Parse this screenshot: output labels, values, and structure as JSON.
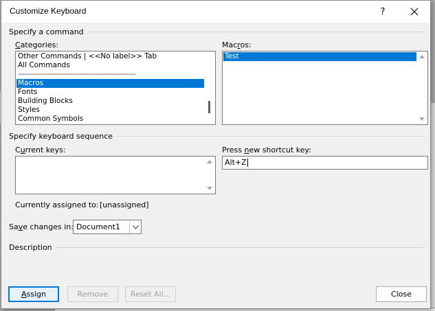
{
  "dialog": {
    "title": "Customize Keyboard",
    "help_label": "?"
  },
  "command_group": {
    "heading": "Specify a command",
    "categories_label_pre": "",
    "categories_label_u": "C",
    "categories_label_post": "ategories:",
    "categories": [
      {
        "label": "Other Commands | <<No label>> Tab",
        "selected": false
      },
      {
        "label": "All Commands",
        "selected": false
      },
      {
        "label": "----------------------------------------------------",
        "selected": false,
        "separator": true
      },
      {
        "label": "Macros",
        "selected": true
      },
      {
        "label": "Fonts",
        "selected": false
      },
      {
        "label": "Building Blocks",
        "selected": false
      },
      {
        "label": "Styles",
        "selected": false
      },
      {
        "label": "Common Symbols",
        "selected": false
      }
    ],
    "macros_label_pre": "Mac",
    "macros_label_u": "r",
    "macros_label_post": "os:",
    "macros": [
      {
        "label": "Test",
        "selected": true
      }
    ]
  },
  "keyboard_group": {
    "heading": "Specify keyboard sequence",
    "current_keys_label_pre": "C",
    "current_keys_label_u": "u",
    "current_keys_label_post": "rrent keys:",
    "press_label_pre": "Press ",
    "press_label_u": "n",
    "press_label_post": "ew shortcut key:",
    "shortcut_value": "Alt+Z",
    "assigned_label": "Currently assigned to:",
    "assigned_value": "[unassigned]"
  },
  "save": {
    "label_pre": "Sa",
    "label_u": "v",
    "label_post": "e changes in:",
    "value": "Document1"
  },
  "description": {
    "heading": "Description"
  },
  "buttons": {
    "assign_u": "A",
    "assign_rest": "ssign",
    "remove": "Remove",
    "reset_all": "Reset All...",
    "close": "Close"
  },
  "colors": {
    "accent": "#0078d7",
    "dialog_bg": "#f0f0f0"
  }
}
